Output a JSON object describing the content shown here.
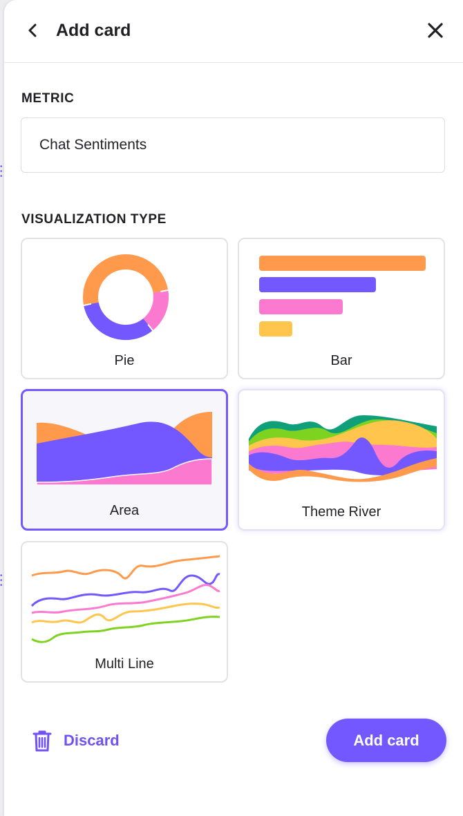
{
  "header": {
    "title": "Add card",
    "back_icon": "chevron-left-icon",
    "close_icon": "close-icon"
  },
  "metric": {
    "label": "METRIC",
    "value": "Chat Sentiments"
  },
  "visualization": {
    "label": "VISUALIZATION TYPE",
    "selected": "Area",
    "options": [
      {
        "label": "Pie",
        "icon": "pie-chart-icon"
      },
      {
        "label": "Bar",
        "icon": "bar-chart-icon"
      },
      {
        "label": "Area",
        "icon": "area-chart-icon"
      },
      {
        "label": "Theme River",
        "icon": "theme-river-chart-icon"
      },
      {
        "label": "Multi Line",
        "icon": "multi-line-chart-icon"
      }
    ]
  },
  "footer": {
    "discard_label": "Discard",
    "discard_icon": "trash-icon",
    "add_label": "Add card"
  },
  "colors": {
    "accent": "#7357FF",
    "orange": "#FF9A4D",
    "purple": "#7357FF",
    "pink": "#FB7AD0",
    "yellow": "#FFC54D",
    "green": "#7ED321",
    "teal": "#0FA07A"
  }
}
